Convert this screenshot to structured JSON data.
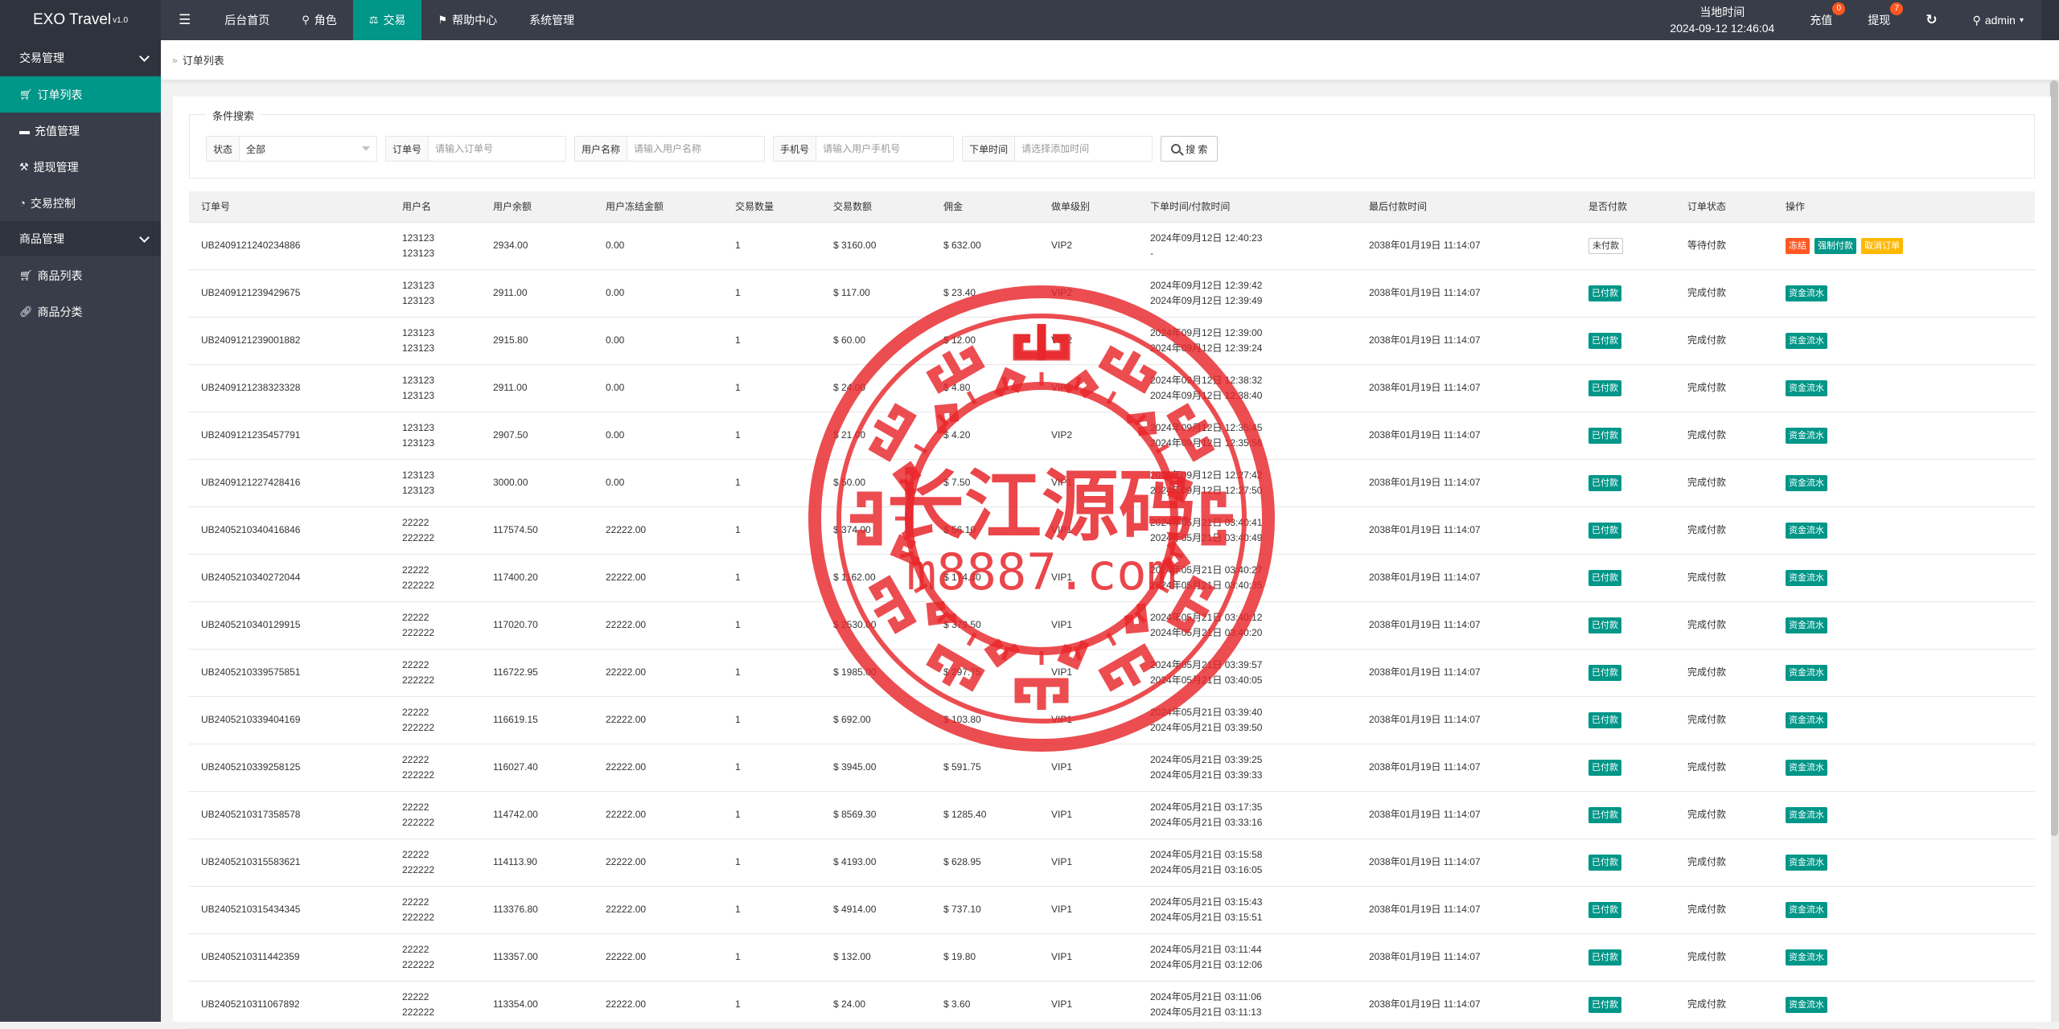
{
  "app": {
    "name": "EXO Travel",
    "version": "v1.0"
  },
  "topnav": {
    "items": [
      {
        "label": "后台首页",
        "icon": ""
      },
      {
        "label": "角色",
        "icon": "user-icon"
      },
      {
        "label": "交易",
        "icon": "balance-icon"
      },
      {
        "label": "帮助中心",
        "icon": "flag-icon"
      },
      {
        "label": "系统管理",
        "icon": ""
      }
    ],
    "active_index": 2
  },
  "header_right": {
    "time_label": "当地时间",
    "time_value": "2024-09-12 12:46:04",
    "recharge_label": "充值",
    "recharge_count": "0",
    "withdraw_label": "提现",
    "withdraw_count": "7",
    "user": "admin"
  },
  "sidebar": {
    "groups": [
      {
        "label": "交易管理",
        "items": [
          {
            "label": "订单列表",
            "icon": "cart-icon",
            "active": true
          },
          {
            "label": "充值管理",
            "icon": "chat-icon"
          },
          {
            "label": "提现管理",
            "icon": "hammer-icon"
          },
          {
            "label": "交易控制",
            "icon": "dashboard-icon"
          }
        ]
      },
      {
        "label": "商品管理",
        "items": [
          {
            "label": "商品列表",
            "icon": "cart-icon"
          },
          {
            "label": "商品分类",
            "icon": "link-icon"
          }
        ]
      }
    ]
  },
  "breadcrumb": "订单列表",
  "search": {
    "legend": "条件搜索",
    "status_label": "状态",
    "status_value": "全部",
    "order_label": "订单号",
    "order_placeholder": "请输入订单号",
    "username_label": "用户名称",
    "username_placeholder": "请输入用户名称",
    "phone_label": "手机号",
    "phone_placeholder": "请输入用户手机号",
    "time_label": "下单时间",
    "time_placeholder": "请选择添加时间",
    "button": "搜 索"
  },
  "table": {
    "columns": [
      "订单号",
      "用户名",
      "用户余额",
      "用户冻结金额",
      "交易数量",
      "交易数额",
      "佣金",
      "做单级别",
      "下单时间/付款时间",
      "最后付款时间",
      "是否付款",
      "订单状态",
      "操作"
    ],
    "rows": [
      {
        "id": "UB2409121240234886",
        "user1": "123123",
        "user2": "123123",
        "balance": "2934.00",
        "frozen": "0.00",
        "qty": "1",
        "amount": "$ 3160.00",
        "commission": "$ 632.00",
        "level": "VIP2",
        "t1": "2024年09月12日 12:40:23",
        "t2": "-",
        "last": "2038年01月19日 11:14:07",
        "paid": "未付款",
        "paid_ok": false,
        "status": "等待付款",
        "actions": [
          "冻结",
          "强制付款",
          "取消订单"
        ]
      },
      {
        "id": "UB2409121239429675",
        "user1": "123123",
        "user2": "123123",
        "balance": "2911.00",
        "frozen": "0.00",
        "qty": "1",
        "amount": "$ 117.00",
        "commission": "$ 23.40",
        "level": "VIP2",
        "t1": "2024年09月12日 12:39:42",
        "t2": "2024年09月12日 12:39:49",
        "last": "2038年01月19日 11:14:07",
        "paid": "已付款",
        "paid_ok": true,
        "status": "完成付款",
        "actions": [
          "资金流水"
        ]
      },
      {
        "id": "UB2409121239001882",
        "user1": "123123",
        "user2": "123123",
        "balance": "2915.80",
        "frozen": "0.00",
        "qty": "1",
        "amount": "$ 60.00",
        "commission": "$ 12.00",
        "level": "VIP2",
        "t1": "2024年09月12日 12:39:00",
        "t2": "2024年09月12日 12:39:24",
        "last": "2038年01月19日 11:14:07",
        "paid": "已付款",
        "paid_ok": true,
        "status": "完成付款",
        "actions": [
          "资金流水"
        ]
      },
      {
        "id": "UB2409121238323328",
        "user1": "123123",
        "user2": "123123",
        "balance": "2911.00",
        "frozen": "0.00",
        "qty": "1",
        "amount": "$ 24.00",
        "commission": "$ 4.80",
        "level": "VIP2",
        "t1": "2024年09月12日 12:38:32",
        "t2": "2024年09月12日 12:38:40",
        "last": "2038年01月19日 11:14:07",
        "paid": "已付款",
        "paid_ok": true,
        "status": "完成付款",
        "actions": [
          "资金流水"
        ]
      },
      {
        "id": "UB2409121235457791",
        "user1": "123123",
        "user2": "123123",
        "balance": "2907.50",
        "frozen": "0.00",
        "qty": "1",
        "amount": "$ 21.00",
        "commission": "$ 4.20",
        "level": "VIP2",
        "t1": "2024年09月12日 12:35:45",
        "t2": "2024年09月12日 12:35:56",
        "last": "2038年01月19日 11:14:07",
        "paid": "已付款",
        "paid_ok": true,
        "status": "完成付款",
        "actions": [
          "资金流水"
        ]
      },
      {
        "id": "UB2409121227428416",
        "user1": "123123",
        "user2": "123123",
        "balance": "3000.00",
        "frozen": "0.00",
        "qty": "1",
        "amount": "$ 50.00",
        "commission": "$ 7.50",
        "level": "VIP1",
        "t1": "2024年09月12日 12:27:42",
        "t2": "2024年09月12日 12:27:50",
        "last": "2038年01月19日 11:14:07",
        "paid": "已付款",
        "paid_ok": true,
        "status": "完成付款",
        "actions": [
          "资金流水"
        ]
      },
      {
        "id": "UB2405210340416846",
        "user1": "22222",
        "user2": "222222",
        "balance": "117574.50",
        "frozen": "22222.00",
        "qty": "1",
        "amount": "$ 374.00",
        "commission": "$ 56.10",
        "level": "VIP1",
        "t1": "2024年05月21日 03:40:41",
        "t2": "2024年05月21日 03:40:49",
        "last": "2038年01月19日 11:14:07",
        "paid": "已付款",
        "paid_ok": true,
        "status": "完成付款",
        "actions": [
          "资金流水"
        ]
      },
      {
        "id": "UB2405210340272044",
        "user1": "22222",
        "user2": "222222",
        "balance": "117400.20",
        "frozen": "22222.00",
        "qty": "1",
        "amount": "$ 1162.00",
        "commission": "$ 174.30",
        "level": "VIP1",
        "t1": "2024年05月21日 03:40:27",
        "t2": "2024年05月21日 03:40:35",
        "last": "2038年01月19日 11:14:07",
        "paid": "已付款",
        "paid_ok": true,
        "status": "完成付款",
        "actions": [
          "资金流水"
        ]
      },
      {
        "id": "UB2405210340129915",
        "user1": "22222",
        "user2": "222222",
        "balance": "117020.70",
        "frozen": "22222.00",
        "qty": "1",
        "amount": "$ 2530.00",
        "commission": "$ 379.50",
        "level": "VIP1",
        "t1": "2024年05月21日 03:40:12",
        "t2": "2024年05月21日 03:40:20",
        "last": "2038年01月19日 11:14:07",
        "paid": "已付款",
        "paid_ok": true,
        "status": "完成付款",
        "actions": [
          "资金流水"
        ]
      },
      {
        "id": "UB2405210339575851",
        "user1": "22222",
        "user2": "222222",
        "balance": "116722.95",
        "frozen": "22222.00",
        "qty": "1",
        "amount": "$ 1985.00",
        "commission": "$ 297.75",
        "level": "VIP1",
        "t1": "2024年05月21日 03:39:57",
        "t2": "2024年05月21日 03:40:05",
        "last": "2038年01月19日 11:14:07",
        "paid": "已付款",
        "paid_ok": true,
        "status": "完成付款",
        "actions": [
          "资金流水"
        ]
      },
      {
        "id": "UB2405210339404169",
        "user1": "22222",
        "user2": "222222",
        "balance": "116619.15",
        "frozen": "22222.00",
        "qty": "1",
        "amount": "$ 692.00",
        "commission": "$ 103.80",
        "level": "VIP1",
        "t1": "2024年05月21日 03:39:40",
        "t2": "2024年05月21日 03:39:50",
        "last": "2038年01月19日 11:14:07",
        "paid": "已付款",
        "paid_ok": true,
        "status": "完成付款",
        "actions": [
          "资金流水"
        ]
      },
      {
        "id": "UB2405210339258125",
        "user1": "22222",
        "user2": "222222",
        "balance": "116027.40",
        "frozen": "22222.00",
        "qty": "1",
        "amount": "$ 3945.00",
        "commission": "$ 591.75",
        "level": "VIP1",
        "t1": "2024年05月21日 03:39:25",
        "t2": "2024年05月21日 03:39:33",
        "last": "2038年01月19日 11:14:07",
        "paid": "已付款",
        "paid_ok": true,
        "status": "完成付款",
        "actions": [
          "资金流水"
        ]
      },
      {
        "id": "UB2405210317358578",
        "user1": "22222",
        "user2": "222222",
        "balance": "114742.00",
        "frozen": "22222.00",
        "qty": "1",
        "amount": "$ 8569.30",
        "commission": "$ 1285.40",
        "level": "VIP1",
        "t1": "2024年05月21日 03:17:35",
        "t2": "2024年05月21日 03:33:16",
        "last": "2038年01月19日 11:14:07",
        "paid": "已付款",
        "paid_ok": true,
        "status": "完成付款",
        "actions": [
          "资金流水"
        ]
      },
      {
        "id": "UB2405210315583621",
        "user1": "22222",
        "user2": "222222",
        "balance": "114113.90",
        "frozen": "22222.00",
        "qty": "1",
        "amount": "$ 4193.00",
        "commission": "$ 628.95",
        "level": "VIP1",
        "t1": "2024年05月21日 03:15:58",
        "t2": "2024年05月21日 03:16:05",
        "last": "2038年01月19日 11:14:07",
        "paid": "已付款",
        "paid_ok": true,
        "status": "完成付款",
        "actions": [
          "资金流水"
        ]
      },
      {
        "id": "UB2405210315434345",
        "user1": "22222",
        "user2": "222222",
        "balance": "113376.80",
        "frozen": "22222.00",
        "qty": "1",
        "amount": "$ 4914.00",
        "commission": "$ 737.10",
        "level": "VIP1",
        "t1": "2024年05月21日 03:15:43",
        "t2": "2024年05月21日 03:15:51",
        "last": "2038年01月19日 11:14:07",
        "paid": "已付款",
        "paid_ok": true,
        "status": "完成付款",
        "actions": [
          "资金流水"
        ]
      },
      {
        "id": "UB2405210311442359",
        "user1": "22222",
        "user2": "222222",
        "balance": "113357.00",
        "frozen": "22222.00",
        "qty": "1",
        "amount": "$ 132.00",
        "commission": "$ 19.80",
        "level": "VIP1",
        "t1": "2024年05月21日 03:11:44",
        "t2": "2024年05月21日 03:12:06",
        "last": "2038年01月19日 11:14:07",
        "paid": "已付款",
        "paid_ok": true,
        "status": "完成付款",
        "actions": [
          "资金流水"
        ]
      },
      {
        "id": "UB2405210311067892",
        "user1": "22222",
        "user2": "222222",
        "balance": "113354.00",
        "frozen": "22222.00",
        "qty": "1",
        "amount": "$ 24.00",
        "commission": "$ 3.60",
        "level": "VIP1",
        "t1": "2024年05月21日 03:11:06",
        "t2": "2024年05月21日 03:11:13",
        "last": "2038年01月19日 11:14:07",
        "paid": "已付款",
        "paid_ok": true,
        "status": "完成付款",
        "actions": [
          "资金流水"
        ]
      }
    ]
  },
  "watermark": {
    "line1": "长江源码",
    "line2": "m8887.com",
    "color": "#e8262a"
  }
}
